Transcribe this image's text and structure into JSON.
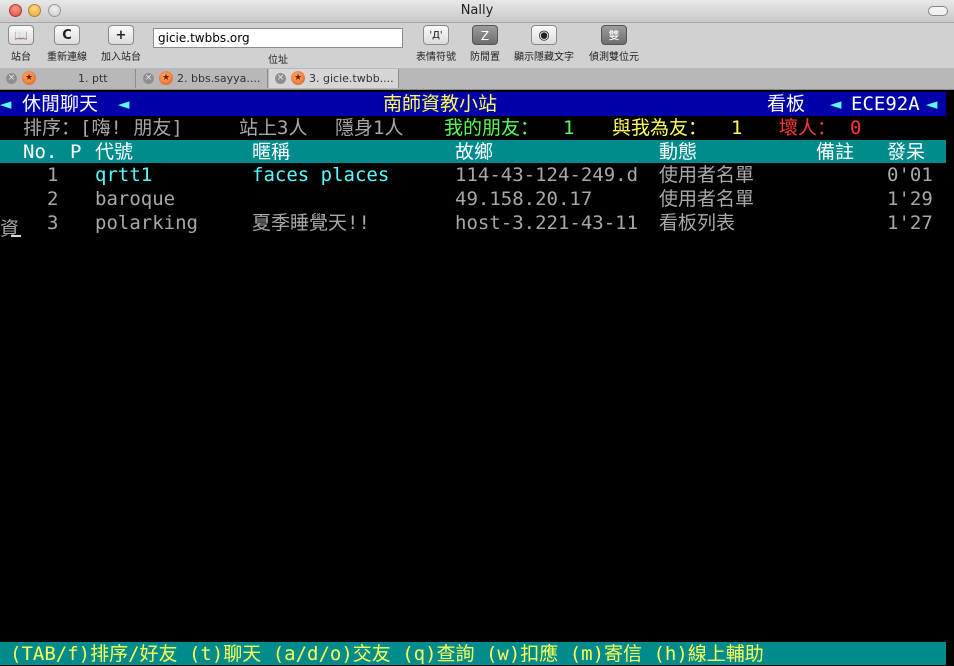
{
  "window": {
    "title": "Nally"
  },
  "toolbar": {
    "sites": {
      "label": "站台",
      "icon": "book-icon",
      "glyph": "📖"
    },
    "reconnect": {
      "label": "重新連線",
      "icon": "reload-icon",
      "glyph": "C"
    },
    "add_site": {
      "label": "加入站台",
      "icon": "plus-icon",
      "glyph": "+"
    },
    "address": {
      "value": "gicie.twbbs.org",
      "label": "位址"
    },
    "emoticons": {
      "label": "表情符號",
      "icon": "emoticon-icon",
      "glyph": "'Д'"
    },
    "anti_idle": {
      "label": "防閒置",
      "icon": "anti-idle-icon",
      "glyph": "Z"
    },
    "show_hidden": {
      "label": "顯示隱藏文字",
      "icon": "eye-icon",
      "glyph": "◉"
    },
    "detect_dbcs": {
      "label": "偵測雙位元",
      "icon": "double-byte-icon",
      "glyph": "雙"
    }
  },
  "tabs": [
    {
      "label": "1. ptt"
    },
    {
      "label": "2. bbs.sayya...."
    },
    {
      "label": "3. gicie.twbb...."
    }
  ],
  "terminal": {
    "header": {
      "left": "休閒聊天",
      "center": "南師資教小站",
      "board_label": "看板",
      "board": "ECE92A"
    },
    "status": {
      "sort": "排序：[嗨! 朋友]",
      "online": "站上3人",
      "hidden": "隱身1人",
      "friends_label": "我的朋友：",
      "friends_count": "1",
      "mutual_label": "與我為友：",
      "mutual_count": "1",
      "bad_label": "壞人：",
      "bad_count": "0"
    },
    "columns": [
      "No.",
      "P",
      "代號",
      "暱稱",
      "故鄉",
      "動態",
      "備註",
      "發呆"
    ],
    "rows": [
      {
        "no": "1",
        "id": "qrtt1",
        "nick": "faces places",
        "from": "114-43-124-249.d",
        "status": "使用者名單",
        "idle": "0'01"
      },
      {
        "no": "2",
        "id": "baroque",
        "nick": "",
        "from": "49.158.20.17",
        "status": "使用者名單",
        "idle": "1'29"
      },
      {
        "no": "3",
        "id": "polarking",
        "nick": "夏季睡覺天!!",
        "from": "host-3.221-43-11",
        "status": "看板列表",
        "idle": "1'27"
      }
    ],
    "cursor_char": "資",
    "footer": "(TAB/f)排序/好友 (t)聊天 (a/d/o)交友 (q)查詢 (w)扣應 (m)寄信 (h)線上輔助"
  },
  "colors": {
    "header_bg": "#0000a8",
    "column_bar_bg": "#008c8c",
    "highlight_text": "#55ffff",
    "friend_count": "#55ff55",
    "bad_count": "#ff3535"
  }
}
